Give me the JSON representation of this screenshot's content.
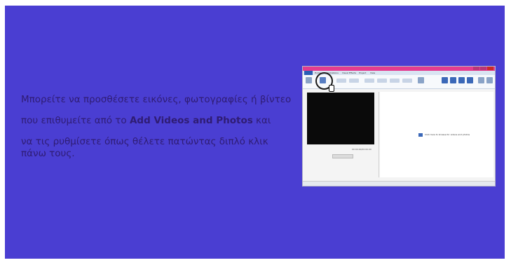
{
  "slide": {
    "background": "#4a3ed2",
    "text_color": "#2f1c73",
    "lines": {
      "p1": "Μπορείτε να προσθέσετε εικόνες, φωτογραφίες ή βίντεο",
      "p2_before": "που επιθυμείτε από το ",
      "p2_bold": "Add Videos and Photos",
      "p2_after": " και",
      "p3": "να τις ρυθμίσετε όπως θέλετε πατώντας διπλό κλικ πάνω τους."
    }
  },
  "screenshot": {
    "app": "Windows Movie Maker",
    "titlebar_color": "#e33c8f",
    "menu": [
      "Home",
      "Animations",
      "Visual Effects",
      "Project",
      "View"
    ],
    "timecode": "00:00.00/00:00.00",
    "hint": "Click here to browse for videos and photos",
    "icons": [
      "add-videos-photos-icon",
      "cursor-hand-icon",
      "play-icon"
    ]
  }
}
